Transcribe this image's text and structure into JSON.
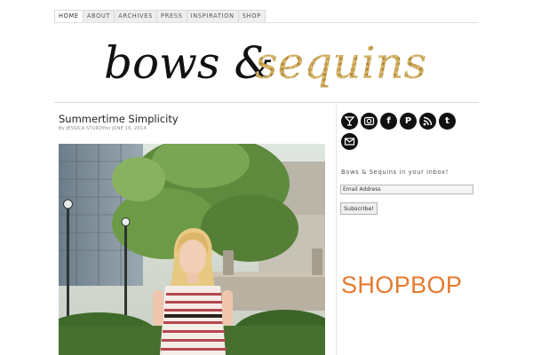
{
  "nav": {
    "items": [
      {
        "label": "HOME",
        "active": true
      },
      {
        "label": "ABOUT",
        "active": false
      },
      {
        "label": "ARCHIVES",
        "active": false
      },
      {
        "label": "PRESS",
        "active": false
      },
      {
        "label": "INSPIRATION",
        "active": false
      },
      {
        "label": "SHOP",
        "active": false
      }
    ]
  },
  "header": {
    "logo_text": "bows & sequins",
    "logo_part1": "bows &",
    "logo_part2": "sequins",
    "accent_color": "#c8a45a"
  },
  "post": {
    "title": "Summertime Simplicity",
    "meta_by": "By",
    "author": "JESSICA STURDY",
    "meta_on": "on",
    "date": "JUNE 16, 2014"
  },
  "sidebar": {
    "social_icons": [
      "martini-icon",
      "camera-icon",
      "facebook-icon",
      "pinterest-icon",
      "rss-icon",
      "tumblr-icon",
      "email-icon"
    ],
    "newsletter_label": "Bows & Sequins in your inbox!",
    "email_value": "Email Address",
    "subscribe_label": "Subscribe!",
    "ad_text": "SHOPBOP",
    "ad_color": "#e67a2e"
  }
}
